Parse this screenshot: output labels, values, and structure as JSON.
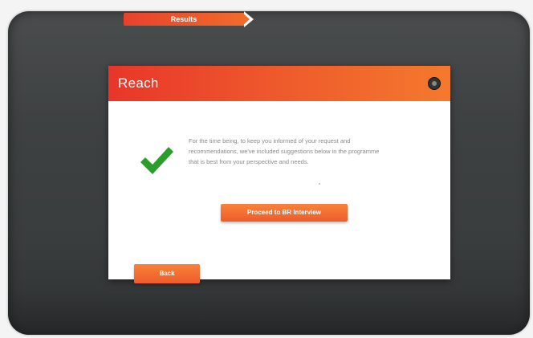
{
  "progress": {
    "step_label": "Results"
  },
  "dialog": {
    "title": "Reach",
    "close_icon": "close-icon",
    "status_icon": "check-icon",
    "message_lines": [
      "For the time being, to keep you informed of your request and",
      "recommendations, we've included suggestions below in the programme",
      "that is best from your perspective and needs."
    ],
    "primary_button": "Proceed to BR Interview",
    "back_button": "Back"
  },
  "colors": {
    "accent_start": "#e8362a",
    "accent_end": "#f4792d",
    "check": "#2a9d2a",
    "frame": "#3e4142"
  }
}
